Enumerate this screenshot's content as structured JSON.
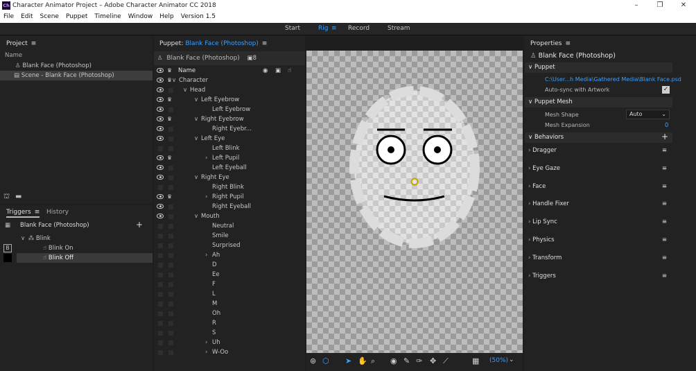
{
  "titlebar": {
    "logo": "Ch",
    "title": "Character Animator Project – Adobe Character Animator CC 2018",
    "minimize": "–",
    "maximize": "❐",
    "close": "✕"
  },
  "menu": [
    "File",
    "Edit",
    "Scene",
    "Puppet",
    "Timeline",
    "Window",
    "Help",
    "Version 1.5"
  ],
  "modes": {
    "start": "Start",
    "rig": "Rig",
    "record": "Record",
    "stream": "Stream"
  },
  "project": {
    "title": "Project",
    "col_name": "Name",
    "items": [
      "Blank Face (Photoshop)",
      "Scene - Blank Face (Photoshop)"
    ]
  },
  "triggers": {
    "tab_triggers": "Triggers",
    "tab_history": "History",
    "puppet": "Blank Face (Photoshop)",
    "group": "Blink",
    "key": "B",
    "items": [
      "Blink On",
      "Blink Off"
    ]
  },
  "puppet_panel": {
    "label": "Puppet:",
    "name": "Blank Face (Photoshop)",
    "header_name": "Blank Face (Photoshop)",
    "count": "8",
    "col_name": "Name",
    "layers": [
      {
        "name": "Character",
        "indent": 0,
        "arrow": "∨",
        "eye": true,
        "crown": true
      },
      {
        "name": "Head",
        "indent": 1,
        "arrow": "∨",
        "eye": true,
        "crown": false
      },
      {
        "name": "Left Eyebrow",
        "indent": 2,
        "arrow": "∨",
        "eye": true,
        "crown": true
      },
      {
        "name": "Left Eyebrow",
        "indent": 3,
        "arrow": "",
        "eye": true,
        "crown": false
      },
      {
        "name": "Right Eyebrow",
        "indent": 2,
        "arrow": "∨",
        "eye": true,
        "crown": true
      },
      {
        "name": "Right Eyebr...",
        "indent": 3,
        "arrow": "",
        "eye": true,
        "crown": false
      },
      {
        "name": "Left Eye",
        "indent": 2,
        "arrow": "∨",
        "eye": true,
        "crown": false
      },
      {
        "name": "Left Blink",
        "indent": 3,
        "arrow": "",
        "eye": false,
        "crown": false,
        "hand": true
      },
      {
        "name": "Left Pupil",
        "indent": 3,
        "arrow": "›",
        "eye": true,
        "crown": true,
        "hand": true
      },
      {
        "name": "Left Eyeball",
        "indent": 3,
        "arrow": "",
        "eye": true,
        "crown": false,
        "hand": true
      },
      {
        "name": "Right Eye",
        "indent": 2,
        "arrow": "∨",
        "eye": true,
        "crown": false
      },
      {
        "name": "Right Blink",
        "indent": 3,
        "arrow": "",
        "eye": false,
        "crown": false,
        "hand": true
      },
      {
        "name": "Right Pupil",
        "indent": 3,
        "arrow": "›",
        "eye": true,
        "crown": true,
        "hand": true
      },
      {
        "name": "Right Eyeball",
        "indent": 3,
        "arrow": "",
        "eye": true,
        "crown": false,
        "hand": true
      },
      {
        "name": "Mouth",
        "indent": 2,
        "arrow": "∨",
        "eye": true,
        "crown": false
      },
      {
        "name": "Neutral",
        "indent": 3,
        "arrow": "",
        "eye": false,
        "crown": false
      },
      {
        "name": "Smile",
        "indent": 3,
        "arrow": "",
        "eye": false,
        "crown": false
      },
      {
        "name": "Surprised",
        "indent": 3,
        "arrow": "",
        "eye": false,
        "crown": false
      },
      {
        "name": "Ah",
        "indent": 3,
        "arrow": "›",
        "eye": false,
        "crown": false,
        "grid": true
      },
      {
        "name": "D",
        "indent": 3,
        "arrow": "",
        "eye": false,
        "crown": false
      },
      {
        "name": "Ee",
        "indent": 3,
        "arrow": "",
        "eye": false,
        "crown": false
      },
      {
        "name": "F",
        "indent": 3,
        "arrow": "",
        "eye": false,
        "crown": false
      },
      {
        "name": "L",
        "indent": 3,
        "arrow": "",
        "eye": false,
        "crown": false
      },
      {
        "name": "M",
        "indent": 3,
        "arrow": "",
        "eye": false,
        "crown": false
      },
      {
        "name": "Oh",
        "indent": 3,
        "arrow": "",
        "eye": false,
        "crown": false
      },
      {
        "name": "R",
        "indent": 3,
        "arrow": "",
        "eye": false,
        "crown": false
      },
      {
        "name": "S",
        "indent": 3,
        "arrow": "",
        "eye": false,
        "crown": false
      },
      {
        "name": "Uh",
        "indent": 3,
        "arrow": "›",
        "eye": false,
        "crown": false,
        "grid": true
      },
      {
        "name": "W-Oo",
        "indent": 3,
        "arrow": "›",
        "eye": false,
        "crown": false,
        "grid": true
      }
    ]
  },
  "canvas": {
    "zoom": "(50%)"
  },
  "properties": {
    "title": "Properties",
    "puppet_name": "Blank Face (Photoshop)",
    "puppet_section": "Puppet",
    "file_path": "C:\\User...h Media\\Gathered Media\\Blank Face.psd",
    "autosync_label": "Auto-sync with Artwork",
    "autosync": true,
    "mesh_section": "Puppet Mesh",
    "mesh_shape_label": "Mesh Shape",
    "mesh_shape_value": "Auto",
    "mesh_expansion_label": "Mesh Expansion",
    "mesh_expansion_value": "0",
    "behaviors_section": "Behaviors",
    "behaviors": [
      "Dragger",
      "Eye Gaze",
      "Face",
      "Handle Fixer",
      "Lip Sync",
      "Physics",
      "Transform",
      "Triggers"
    ]
  },
  "colors": {
    "accent": "#3aa0ff",
    "panel": "#232323",
    "bg": "#1e1e1e"
  }
}
